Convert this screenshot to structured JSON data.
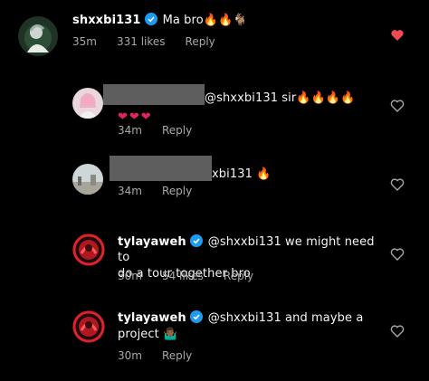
{
  "colors": {
    "background": "#000000",
    "text": "#f5f5f5",
    "meta_text": "#a8a8a8",
    "verified_blue": "#1d9bf0",
    "liked_heart": "#ed4956",
    "redaction_gray": "#5e5e5e"
  },
  "comments": [
    {
      "username": "shxxbi131",
      "verified": true,
      "text": "Ma bro🔥🔥🐐",
      "time": "35m",
      "likes": "331 likes",
      "reply": "Reply",
      "liked": true,
      "avatar_icon": "profile-photo-icon"
    },
    {
      "username": "",
      "verified": false,
      "text": "@shxxbi131 sir🔥🔥🔥🔥",
      "text_line2": "❤❤❤",
      "time": "34m",
      "reply": "Reply",
      "liked": false,
      "avatar_icon": "profile-photo-icon"
    },
    {
      "username": "",
      "verified": false,
      "text": "xbi131 🔥",
      "time": "34m",
      "reply": "Reply",
      "liked": false,
      "avatar_icon": "profile-photo-icon"
    },
    {
      "username": "tylayaweh",
      "verified": true,
      "text": "@shxxbi131 we might need to",
      "text_line2": "do a tour together bro",
      "time": "30m",
      "likes": "54 likes",
      "reply": "Reply",
      "liked": false,
      "avatar_icon": "profile-photo-icon"
    },
    {
      "username": "tylayaweh",
      "verified": true,
      "text": "@shxxbi131 and maybe a",
      "text_line2": "project 🤷🏾‍♂️",
      "time": "30m",
      "reply": "Reply",
      "liked": false,
      "avatar_icon": "profile-photo-icon"
    }
  ]
}
